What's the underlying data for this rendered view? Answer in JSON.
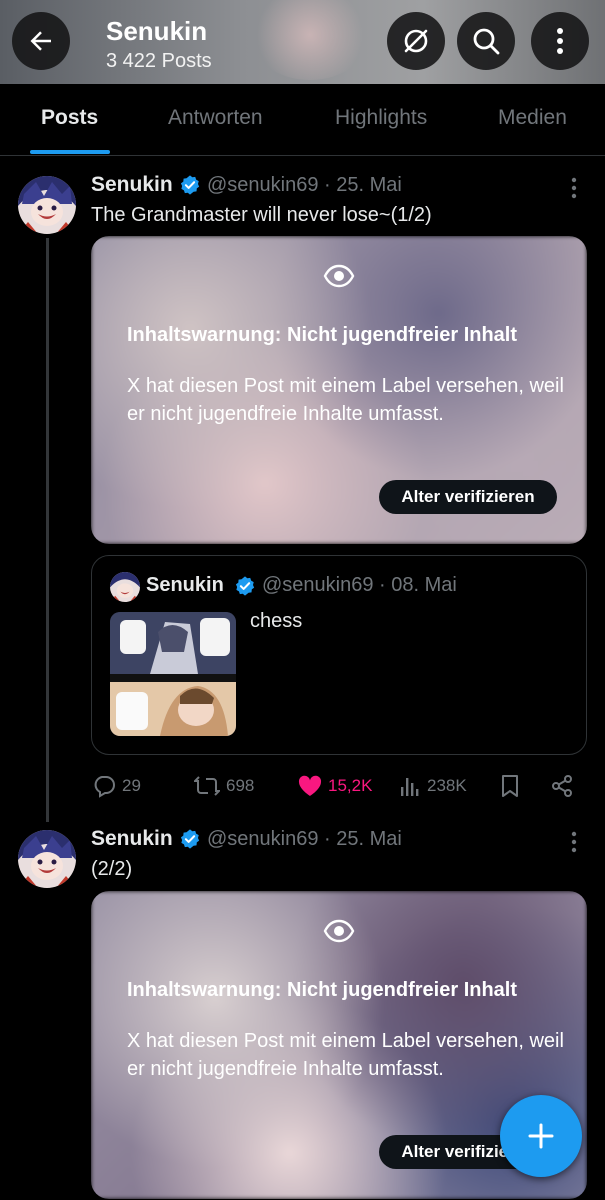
{
  "header": {
    "title": "Senukin",
    "post_count": "3 422 Posts",
    "icons": [
      "back-arrow-icon",
      "grok-icon",
      "search-icon",
      "more-vertical-icon"
    ]
  },
  "tabs": [
    {
      "label": "Posts",
      "active": true
    },
    {
      "label": "Antworten",
      "active": false
    },
    {
      "label": "Highlights",
      "active": false
    },
    {
      "label": "Medien",
      "active": false
    }
  ],
  "posts": [
    {
      "display_name": "Senukin",
      "handle_date": "@senukin69 · 25. Mai",
      "text": "The Grandmaster will never lose~(1/2)",
      "warning": {
        "title": "Inhaltswarnung: Nicht jugendfreier Inhalt",
        "body": "X hat diesen Post mit einem Label versehen, weil er nicht jugendfreie Inhalte umfasst.",
        "button": "Alter verifizieren"
      },
      "quote": {
        "display_name": "Senukin",
        "handle_date": "@senukin69 · 08. Mai",
        "text": "chess"
      },
      "actions": {
        "replies": "29",
        "reposts": "698",
        "likes": "15,2K",
        "views": "238K"
      }
    },
    {
      "display_name": "Senukin",
      "handle_date": "@senukin69 · 25. Mai",
      "text": "(2/2)",
      "warning": {
        "title": "Inhaltswarnung: Nicht jugendfreier Inhalt",
        "body": "X hat diesen Post mit einem Label versehen, weil er nicht jugendfreie Inhalte umfasst.",
        "button": "Alter verifizieren"
      }
    }
  ],
  "colors": {
    "accent": "#1d9bf0",
    "like": "#f91880",
    "muted": "#71767b",
    "background": "#000000"
  }
}
